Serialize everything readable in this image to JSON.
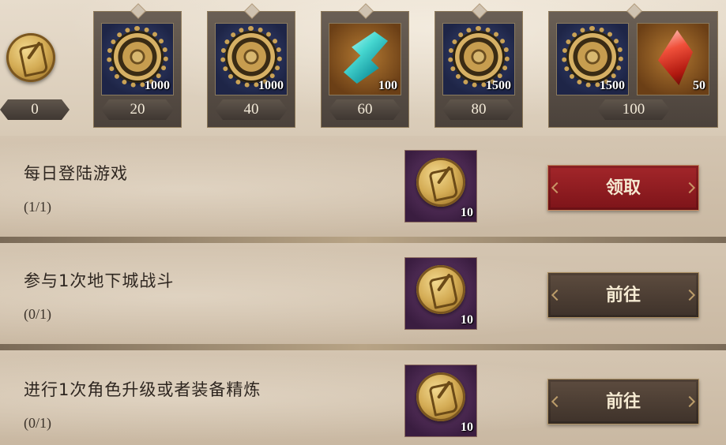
{
  "track": {
    "milestones": [
      {
        "threshold": "0",
        "rewards": []
      },
      {
        "threshold": "20",
        "rewards": [
          {
            "icon": "gear-coin-icon",
            "qty": "1000"
          }
        ]
      },
      {
        "threshold": "40",
        "rewards": [
          {
            "icon": "gear-coin-icon",
            "qty": "1000"
          }
        ]
      },
      {
        "threshold": "60",
        "rewards": [
          {
            "icon": "blue-crystal-icon",
            "qty": "100"
          }
        ]
      },
      {
        "threshold": "80",
        "rewards": [
          {
            "icon": "gear-coin-icon",
            "qty": "1500"
          }
        ]
      },
      {
        "threshold": "100",
        "rewards": [
          {
            "icon": "gear-coin-icon",
            "qty": "1500"
          },
          {
            "icon": "red-crystal-icon",
            "qty": "50"
          }
        ]
      }
    ],
    "current_points_icon": "scroll-coin-icon"
  },
  "tasks": [
    {
      "title": "每日登陆游戏",
      "progress": "(1/1)",
      "reward_icon": "scroll-coin-icon",
      "reward_qty": "10",
      "button": "领取",
      "button_state": "claim"
    },
    {
      "title": "参与1次地下城战斗",
      "progress": "(0/1)",
      "reward_icon": "scroll-coin-icon",
      "reward_qty": "10",
      "button": "前往",
      "button_state": "go"
    },
    {
      "title": "进行1次角色升级或者装备精炼",
      "progress": "(0/1)",
      "reward_icon": "scroll-coin-icon",
      "reward_qty": "10",
      "button": "前往",
      "button_state": "go"
    }
  ],
  "colors": {
    "claim_button": "#9a2126",
    "go_button": "#4e4035",
    "reward_bg_blue": "#2a3360",
    "reward_bg_purple": "#4a2a52"
  }
}
